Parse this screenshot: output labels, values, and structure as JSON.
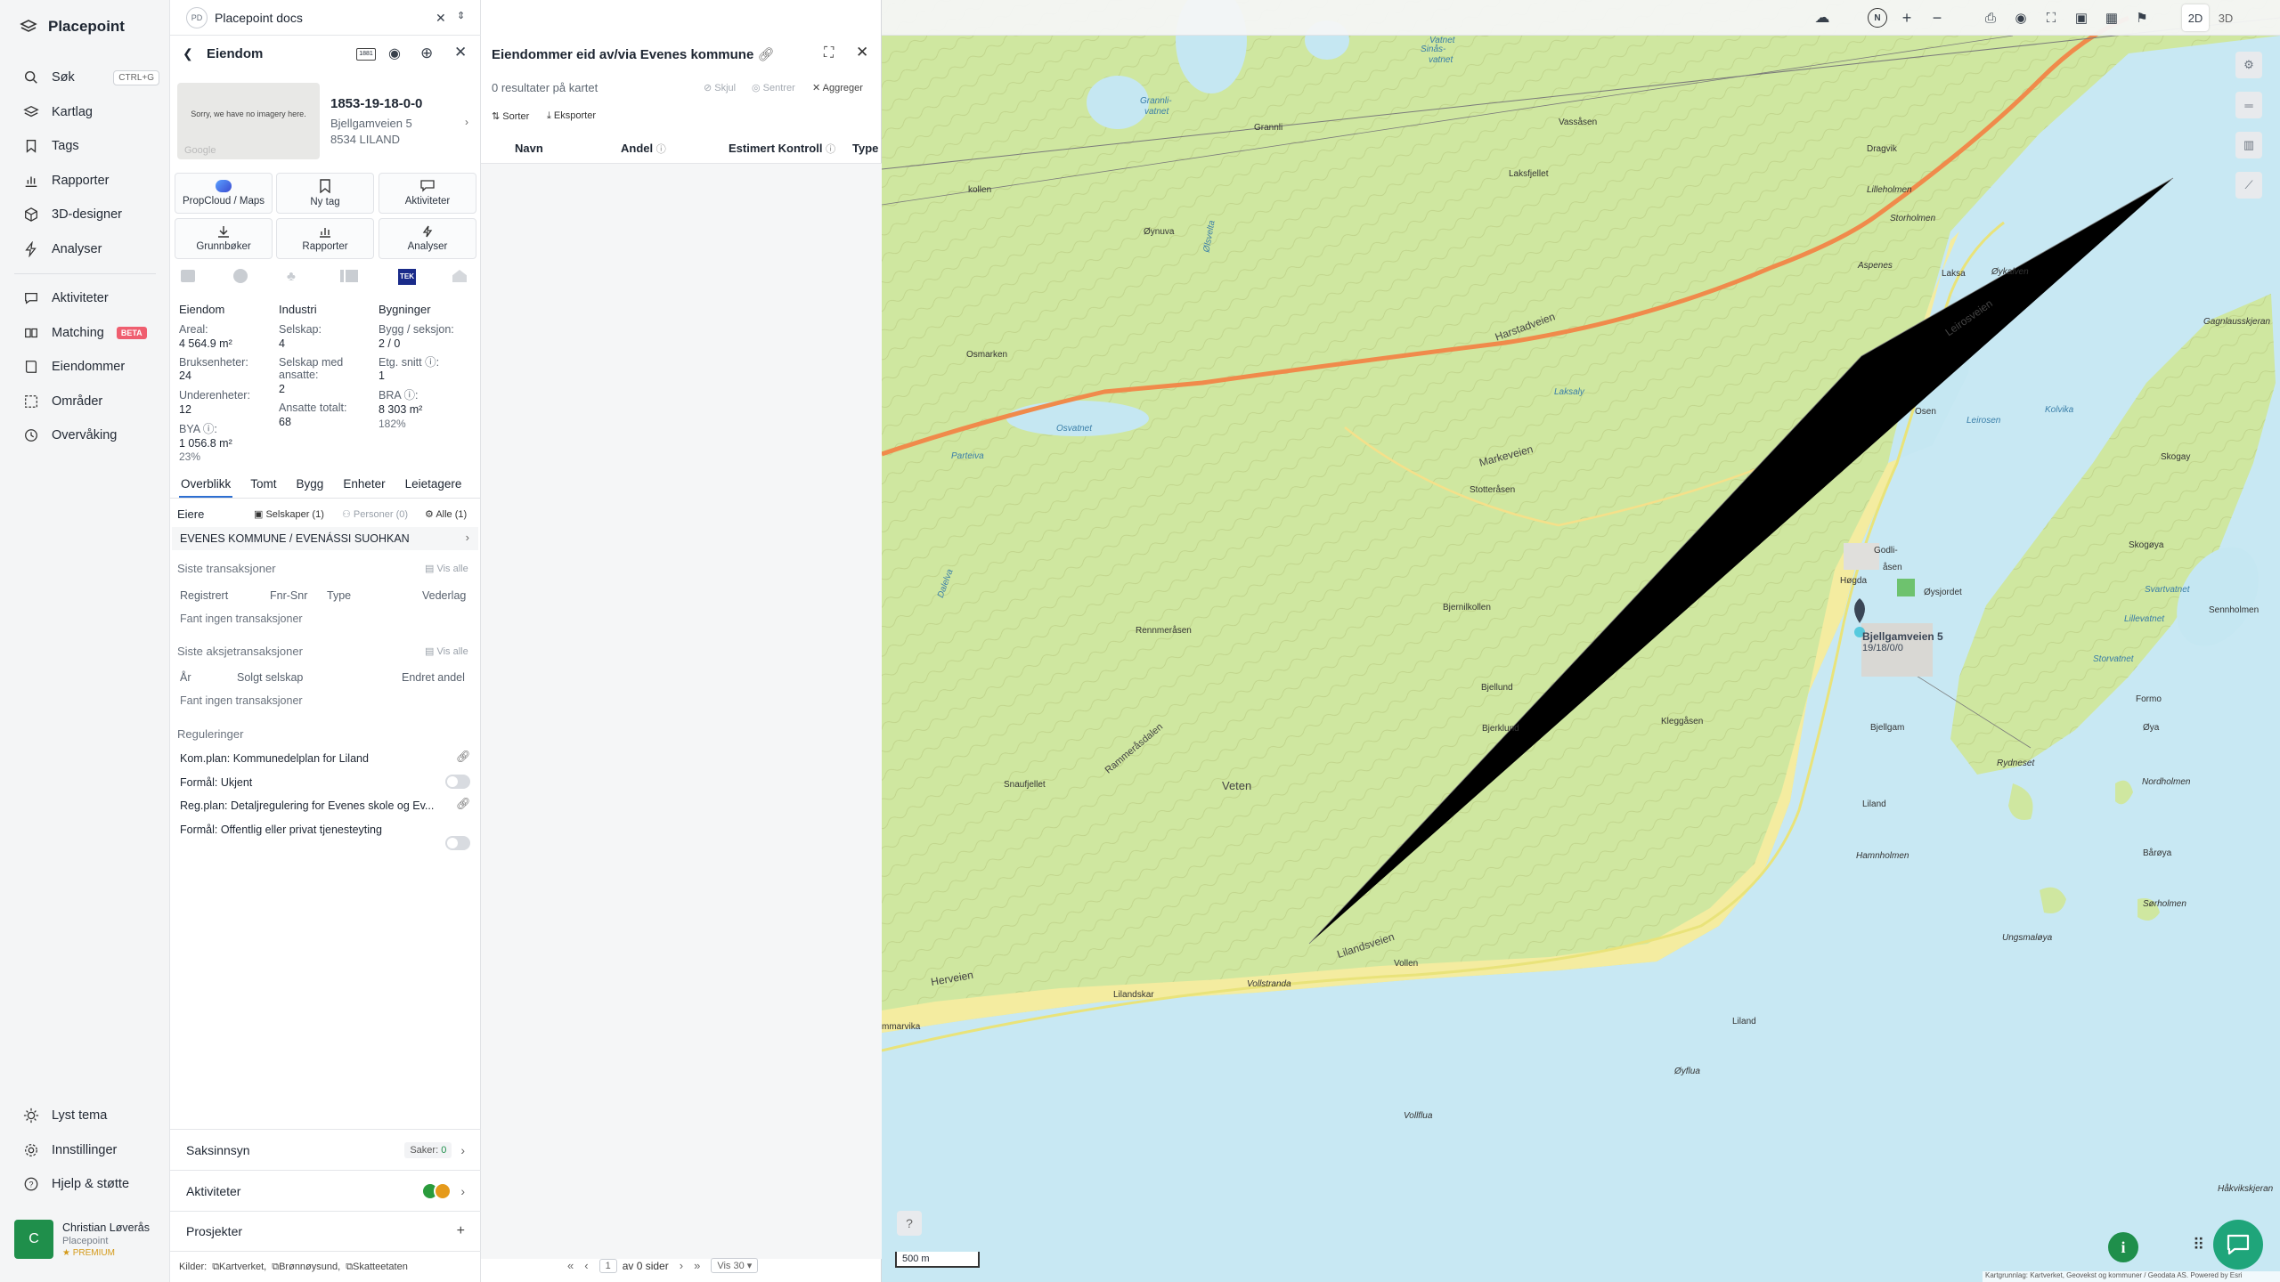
{
  "app": {
    "brand": "Placepoint"
  },
  "sidebar": {
    "items": [
      {
        "label": "Søk",
        "shortcut": "CTRL+G"
      },
      {
        "label": "Kartlag"
      },
      {
        "label": "Tags"
      },
      {
        "label": "Rapporter"
      },
      {
        "label": "3D-designer"
      },
      {
        "label": "Analyser"
      },
      {
        "label": "Aktiviteter"
      },
      {
        "label": "Matching",
        "badge": "BETA"
      },
      {
        "label": "Eiendommer"
      },
      {
        "label": "Områder"
      },
      {
        "label": "Overvåking"
      }
    ],
    "bottom": [
      {
        "label": "Lyst tema"
      },
      {
        "label": "Innstillinger"
      },
      {
        "label": "Hjelp & støtte"
      }
    ],
    "user": {
      "initial": "C",
      "name": "Christian Løverås",
      "org": "Placepoint",
      "plan": "PREMIUM"
    }
  },
  "docs_tab": {
    "badge": "PD",
    "title": "Placepoint docs"
  },
  "property": {
    "header": "Eiendom",
    "imagery_text": "Sorry, we have no imagery here.",
    "google": "Google",
    "id": "1853-19-18-0-0",
    "address": "Bjellgamveien 5",
    "postal": "8534 LILAND",
    "actions": [
      {
        "label": "PropCloud / Maps",
        "icon": "propcloud-icon"
      },
      {
        "label": "Ny tag",
        "icon": "bookmark-icon"
      },
      {
        "label": "Aktiviteter",
        "icon": "chat-icon"
      },
      {
        "label": "Grunnbøker",
        "icon": "download-icon"
      },
      {
        "label": "Rapporter",
        "icon": "chart-icon"
      },
      {
        "label": "Analyser",
        "icon": "bolt-icon"
      }
    ],
    "tek_badge": "TEK",
    "col1": {
      "title": "Eiendom",
      "areal_label": "Areal:",
      "areal": "4 564.9 m²",
      "bruks_label": "Bruksenheter:",
      "bruks": "24",
      "under_label": "Underenheter:",
      "under": "12",
      "bya_label": "BYA ⓘ:",
      "bya": "1 056.8 m²",
      "bya_pct": "23%"
    },
    "col2": {
      "title": "Industri",
      "selskap_label": "Selskap:",
      "selskap": "4",
      "ansatte_label": "Selskap med ansatte:",
      "ansatte": "2",
      "total_label": "Ansatte totalt:",
      "total": "68"
    },
    "col3": {
      "title": "Bygninger",
      "bygg_label": "Bygg / seksjon:",
      "bygg": "2 / 0",
      "etg_label": "Etg. snitt ⓘ:",
      "etg": "1",
      "bra_label": "BRA ⓘ:",
      "bra": "8 303 m²",
      "bra_pct": "182%"
    },
    "tabs": [
      "Overblikk",
      "Tomt",
      "Bygg",
      "Enheter",
      "Leietagere"
    ],
    "owners": {
      "title": "Eiere",
      "selskaper": "Selskaper (1)",
      "personer": "Personer (0)",
      "alle": "Alle (1)",
      "owner": "EVENES KOMMUNE / EVENÁSSI SUOHKAN"
    },
    "trans": {
      "title": "Siste transaksjoner",
      "vis_alle": "Vis alle",
      "cols": [
        "Registrert",
        "Fnr-Snr",
        "Type",
        "Vederlag"
      ],
      "empty": "Fant ingen transaksjoner"
    },
    "aksje": {
      "title": "Siste aksjetransaksjoner",
      "vis_alle": "Vis alle",
      "cols": [
        "År",
        "Solgt selskap",
        "Endret andel"
      ],
      "empty": "Fant ingen transaksjoner"
    },
    "reg": {
      "title": "Reguleringer",
      "items": [
        "Kom.plan: Kommunedelplan for Liland",
        "Formål: Ukjent",
        "Reg.plan: Detaljregulering for Evenes skole og Ev...",
        "Formål: Offentlig eller privat tjenesteyting"
      ]
    },
    "saksinnsyn": {
      "label": "Saksinnsyn",
      "count_label": "Saker:",
      "count": "0"
    },
    "aktiviteter": {
      "label": "Aktiviteter"
    },
    "prosjekter": {
      "label": "Prosjekter",
      "add": "+"
    },
    "sources": {
      "label": "Kilder:",
      "items": [
        "Kartverket,",
        "Brønnøysund,",
        "Skatteetaten"
      ]
    }
  },
  "results": {
    "title": "Eiendommer eid av/via Evenes kommune",
    "count": "0 resultater på kartet",
    "skjul": "Skjul",
    "sentrer": "Sentrer",
    "aggreger": "Aggreger",
    "sorter": "Sorter",
    "eksporter": "Eksporter",
    "columns": [
      "Navn",
      "Andel",
      "Estimert Kontroll",
      "Type"
    ],
    "pagination": {
      "page": "1",
      "of_label": "av 0 sider",
      "per_page": "Vis 30"
    }
  },
  "map": {
    "toolbar": {
      "mode2d": "2D",
      "mode3d": "3D",
      "compass": "N"
    },
    "scale": "500 m",
    "attribution": "Kartgrunnlag: Kartverket, Geovekst og kommuner / Geodata AS. Powered by Esri",
    "pin_label": "Bjellgamveien 5",
    "pin_id": "19/18/0/0",
    "labels": [
      {
        "text": "Vatnet"
      },
      {
        "text": "Sinås-"
      },
      {
        "text": "vatnet"
      },
      {
        "text": "Grannli-"
      },
      {
        "text": "vatnet"
      },
      {
        "text": "Grannli"
      },
      {
        "text": "Vassåsen"
      },
      {
        "text": "Dragvik"
      },
      {
        "text": "Lilleholmen"
      },
      {
        "text": "Storholmen"
      },
      {
        "text": "Laksfjellet"
      },
      {
        "text": "Øynuva"
      },
      {
        "text": "Aspenes"
      },
      {
        "text": "Øykalven"
      },
      {
        "text": "Gagnlausskjeran"
      },
      {
        "text": "Laksa"
      },
      {
        "text": "Leirosveien"
      },
      {
        "text": "Harstadveien"
      },
      {
        "text": "Osmarken"
      },
      {
        "text": "Osvatnet"
      },
      {
        "text": "Parteiva"
      },
      {
        "text": "Markeveien"
      },
      {
        "text": "Osen"
      },
      {
        "text": "Leirosen"
      },
      {
        "text": "Kolvika"
      },
      {
        "text": "Skogay"
      },
      {
        "text": "Stotteråsen"
      },
      {
        "text": "Godli-"
      },
      {
        "text": "åsen"
      },
      {
        "text": "Høgda"
      },
      {
        "text": "Øysjordet"
      },
      {
        "text": "Skogøya"
      },
      {
        "text": "Svartvatnet"
      },
      {
        "text": "Lillevatnet"
      },
      {
        "text": "Sennholmen"
      },
      {
        "text": "Bjernilkollen"
      },
      {
        "text": "Rennmeråsen"
      },
      {
        "text": "Storvatnet"
      },
      {
        "text": "Bjellund"
      },
      {
        "text": "Bjerklund"
      },
      {
        "text": "Bjellgam"
      },
      {
        "text": "Formo"
      },
      {
        "text": "Øya"
      },
      {
        "text": "Kleggåsen"
      },
      {
        "text": "Rydneset"
      },
      {
        "text": "Snaufjellet"
      },
      {
        "text": "Veten"
      },
      {
        "text": "Rammeråsdalen"
      },
      {
        "text": "Liland"
      },
      {
        "text": "Nordholmen"
      },
      {
        "text": "Bårøya"
      },
      {
        "text": "Sørholmen"
      },
      {
        "text": "Hamnholmen"
      },
      {
        "text": "Ungsmaløya"
      },
      {
        "text": "Lilandsveien"
      },
      {
        "text": "Vollen"
      },
      {
        "text": "Herveien"
      },
      {
        "text": "Lilandskar"
      },
      {
        "text": "Vollstranda"
      },
      {
        "text": "Liland"
      },
      {
        "text": "Øyflua"
      },
      {
        "text": "Vollflua"
      },
      {
        "text": "Håkvikskjeran"
      },
      {
        "text": "mmarvika"
      },
      {
        "text": "Dalelva"
      },
      {
        "text": "Laksaly"
      },
      {
        "text": "Ølsvelta"
      },
      {
        "text": "kollen"
      }
    ]
  },
  "colors": {
    "accent": "#2d6fd1",
    "land": "#cfe7a0",
    "water": "#c5e7f2",
    "road": "#f08a4b",
    "green": "#1f8f4b"
  }
}
